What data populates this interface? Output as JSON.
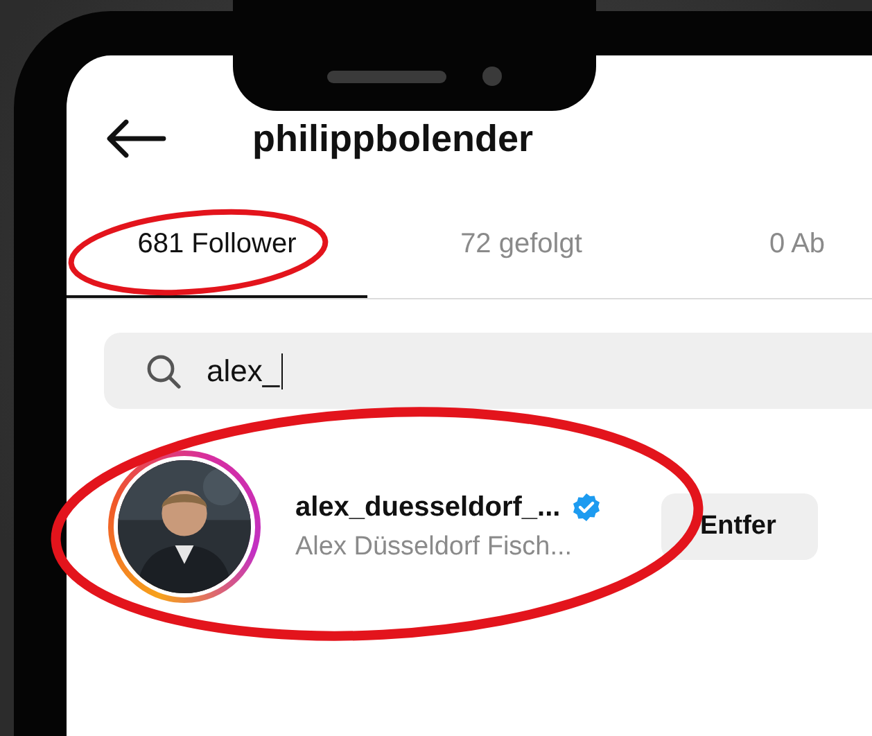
{
  "header": {
    "title": "philippbolender"
  },
  "tabs": [
    {
      "label": "681 Follower",
      "selected": true
    },
    {
      "label": "72 gefolgt",
      "selected": false
    },
    {
      "label": "0 Ab",
      "selected": false
    }
  ],
  "search": {
    "value": "alex_"
  },
  "results": [
    {
      "username": "alex_duesseldorf_...",
      "verified": true,
      "full_name": "Alex Düsseldorf Fisch...",
      "story_ring": true,
      "button": "Entfer"
    }
  ]
}
